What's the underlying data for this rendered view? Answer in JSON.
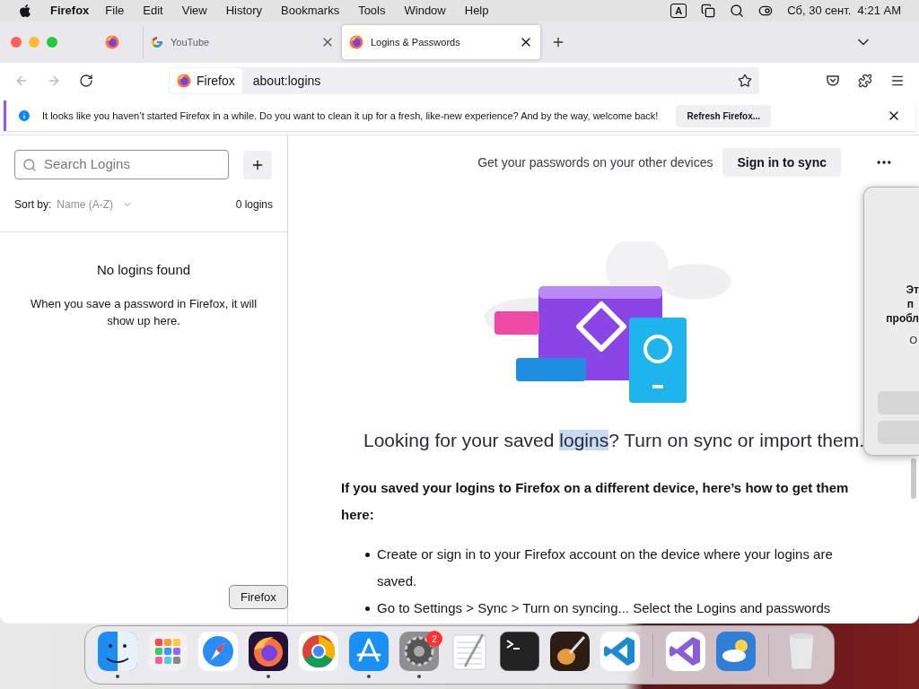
{
  "menubar": {
    "app": "Firefox",
    "menus": [
      "File",
      "Edit",
      "View",
      "History",
      "Bookmarks",
      "Tools",
      "Window",
      "Help"
    ],
    "input_source": "A",
    "clock": "Сб, 30 сент.  4:21 AM"
  },
  "tabs": [
    {
      "kind": "pinned",
      "selected": false
    },
    {
      "kind": "web",
      "title": "YouTube",
      "selected": false
    },
    {
      "kind": "internal",
      "title": "Logins & Passwords",
      "selected": true
    }
  ],
  "address_bar": {
    "identity": "Firefox",
    "url": "about:logins"
  },
  "notification": {
    "message": "It looks like you haven’t started Firefox in a while. Do you want to clean it up for a fresh, like-new experience? And by the way, welcome back!",
    "button": "Refresh Firefox..."
  },
  "sidebar": {
    "search_placeholder": "Search Logins",
    "sort_label": "Sort by:",
    "sort_value": "Name (A-Z)",
    "count": "0 logins",
    "empty_title": "No logins found",
    "empty_message": "When you save a password in Firefox, it will show up here."
  },
  "main": {
    "sync_prompt": "Get your passwords on your other devices",
    "sync_button": "Sign in to sync",
    "heading": {
      "before": "Looking for your saved ",
      "selected_text": "logins",
      "after": "? Turn on sync or import them."
    },
    "intro": "If you saved your logins to Firefox on a different device, here’s how to get them here:",
    "steps": [
      "Create or sign in to your Firefox account on the device where your logins are saved.",
      "Go to Settings > Sync > Turn on syncing... Select the Logins and passwords"
    ]
  },
  "dialog": {
    "lines": [
      "Эт",
      "п",
      "пробл"
    ],
    "note": "О"
  },
  "dock": {
    "tooltip": "Firefox",
    "groups": [
      [
        {
          "running": true
        },
        {
          "running": false
        },
        {
          "running": false
        },
        {
          "running": true
        },
        {
          "running": false
        },
        {
          "running": true
        },
        {
          "running": true,
          "badge": "2"
        },
        {
          "running": false
        },
        {
          "running": false
        },
        {
          "running": false
        },
        {
          "running": false
        }
      ],
      [
        {
          "running": false
        },
        {
          "running": false
        }
      ],
      [
        {
          "running": false
        }
      ]
    ]
  }
}
